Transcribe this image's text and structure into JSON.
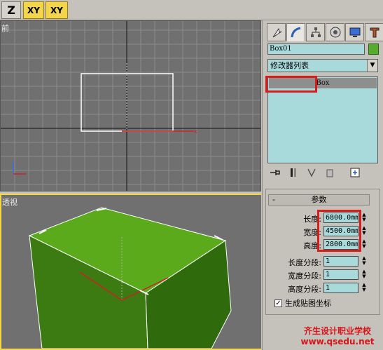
{
  "toolbar": {
    "buttons": [
      {
        "label": "Z"
      },
      {
        "label": "XY"
      },
      {
        "label": "XY"
      }
    ]
  },
  "viewports": {
    "top_label": "前",
    "perspective_label": "透视"
  },
  "panel": {
    "tabs": [
      "create-icon",
      "modify-icon",
      "hierarchy-icon",
      "motion-icon",
      "display-icon",
      "utilities-icon"
    ],
    "object_name": "Box01",
    "object_color": "#57ab2f",
    "modifier_list": "修改器列表",
    "stack_item": "Box",
    "rollout_title": "参数",
    "rollout_toggle": "-",
    "params": [
      {
        "label": "长度:",
        "value": "6800.0mm"
      },
      {
        "label": "宽度:",
        "value": "4500.0mm"
      },
      {
        "label": "高度:",
        "value": "2800.0mm"
      },
      {
        "label": "长度分段:",
        "value": "1"
      },
      {
        "label": "宽度分段:",
        "value": "1"
      },
      {
        "label": "高度分段:",
        "value": "1"
      }
    ],
    "checkbox_label": "生成贴图坐标",
    "checkbox_checked": true
  },
  "watermark": {
    "line1": "齐生设计职业学校",
    "line2": "www.qsedu.net"
  },
  "colors": {
    "highlight": "#d81b1b",
    "field_bg": "#a8dadc",
    "viewport_bg": "#707070",
    "active_border": "#f4d64a"
  }
}
